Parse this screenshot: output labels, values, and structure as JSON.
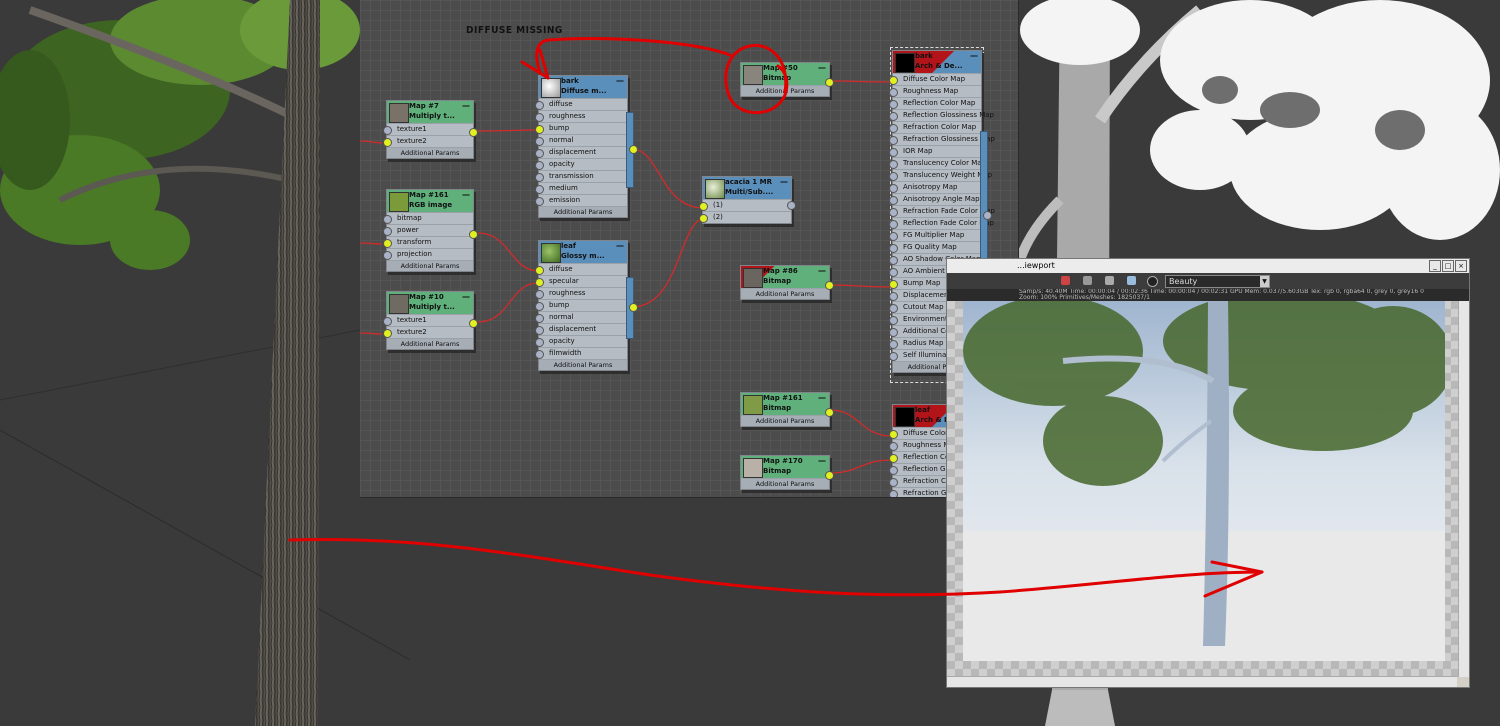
{
  "panel": {
    "label": "DIFFUSE MISSING"
  },
  "nodes": {
    "map7": {
      "t1": "Map #7",
      "t2": "Multiply t...",
      "rows": [
        "texture1",
        "texture2"
      ],
      "foot": "Additional Params"
    },
    "map161a": {
      "t1": "Map #161",
      "t2": "RGB image",
      "rows": [
        "bitmap",
        "power",
        "transform",
        "projection"
      ],
      "foot": "Additional Params"
    },
    "map10": {
      "t1": "Map #10",
      "t2": "Multiply t...",
      "rows": [
        "texture1",
        "texture2"
      ],
      "foot": "Additional Params"
    },
    "barkDiffuse": {
      "t1": "bark",
      "t2": "Diffuse m...",
      "rows": [
        "diffuse",
        "roughness",
        "bump",
        "normal",
        "displacement",
        "opacity",
        "transmission",
        "medium",
        "emission"
      ],
      "foot": "Additional Params"
    },
    "leafGlossy": {
      "t1": "leaf",
      "t2": "Glossy m...",
      "rows": [
        "diffuse",
        "specular",
        "roughness",
        "bump",
        "normal",
        "displacement",
        "opacity",
        "filmwidth"
      ],
      "foot": "Additional Params"
    },
    "acacia": {
      "t1": "acacia 1 MR",
      "t2": "Multi/Sub....",
      "rows": [
        "(1)",
        "(2)"
      ]
    },
    "map50": {
      "t1": "Map #50",
      "t2": "Bitmap",
      "foot": "Additional Params"
    },
    "map86": {
      "t1": "Map #86",
      "t2": "Bitmap",
      "foot": "Additional Params"
    },
    "map161b": {
      "t1": "Map #161",
      "t2": "Bitmap",
      "foot": "Additional Params"
    },
    "map170": {
      "t1": "Map #170",
      "t2": "Bitmap",
      "foot": "Additional Params"
    },
    "barkArch": {
      "t1": "bark",
      "t2": "Arch & De...",
      "rows": [
        "Diffuse Color Map",
        "Roughness Map",
        "Reflection Color Map",
        "Reflection Glossiness Map",
        "Refraction Color Map",
        "Refraction Glossiness Map",
        "IOR Map",
        "Translucency Color Map",
        "Translucency Weight Map",
        "Anisotropy Map",
        "Anisotropy Angle Map",
        "Refraction Fade Color Map",
        "Reflection Fade Color Map",
        "FG Multiplier Map",
        "FG Quality Map",
        "AO Shadow Color Map",
        "AO Ambient Light Color...",
        "Bump Map",
        "Displacement Map",
        "Cutout Map",
        "Environment Map",
        "Additional Color Map",
        "Radius Map",
        "Self Illumination Map"
      ],
      "foot": "Additional Params"
    },
    "leafArch": {
      "t1": "leaf",
      "t2": "Arch & De...",
      "rows": [
        "Diffuse Color Map",
        "Roughness Map",
        "Reflection Color Map",
        "Reflection Glossiness Map",
        "Refraction Color Map",
        "Refraction Glossiness Map"
      ]
    }
  },
  "vfb": {
    "title": "...iewport",
    "channel": "Beauty",
    "stats1": "Samp/s: 40.40M    Time: 00:00:04 / 00:02:36    Time: 00:00:04 / 00:02:31    GPU Mem: 0.037/5.603GB    Tex: rgb 0, rgba64 0, grey 0, grey16 0",
    "stats2": "Zoom: 100%    Primitives/Meshes: 1825037/1"
  }
}
